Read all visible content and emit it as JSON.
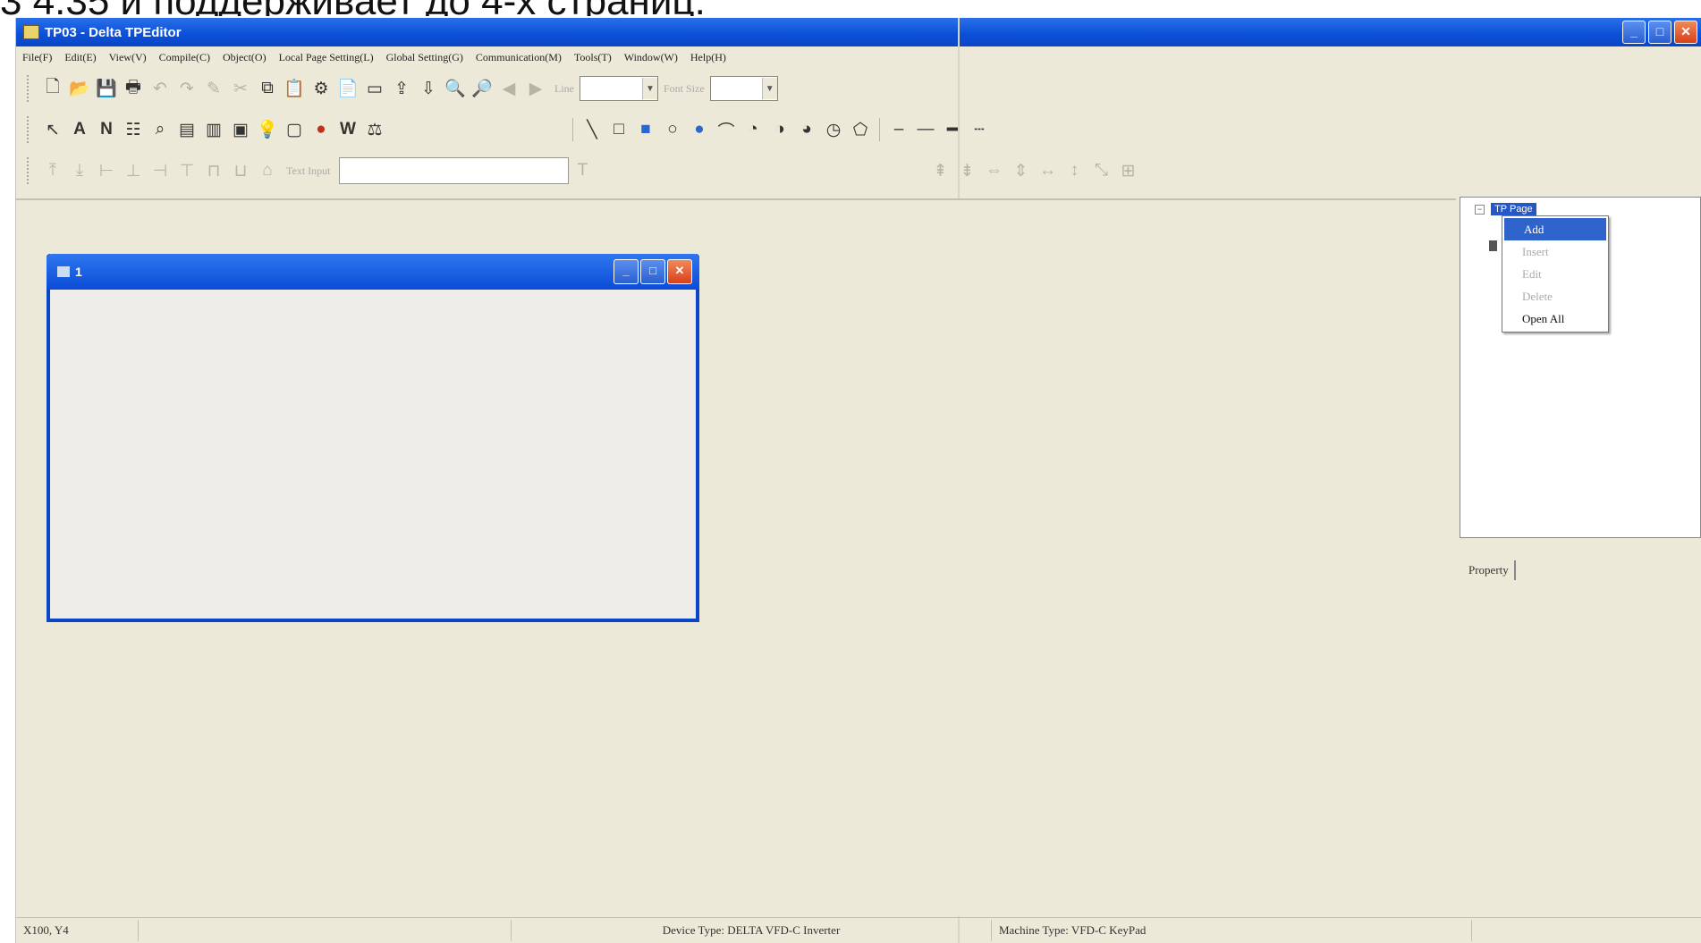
{
  "caption": "3 4.35 и поддерживает до 4-х страниц.",
  "window": {
    "title": "TP03 - Delta TPEditor",
    "minimize_icon": "minimize-icon",
    "maximize_icon": "maximize-icon",
    "close_icon": "close-icon"
  },
  "menu": [
    {
      "label": "File(F)"
    },
    {
      "label": "Edit(E)"
    },
    {
      "label": "View(V)"
    },
    {
      "label": "Compile(C)"
    },
    {
      "label": "Object(O)"
    },
    {
      "label": "Local Page Setting(L)"
    },
    {
      "label": "Global Setting(G)"
    },
    {
      "label": "Communication(M)"
    },
    {
      "label": "Tools(T)"
    },
    {
      "label": "Window(W)"
    },
    {
      "label": "Help(H)"
    }
  ],
  "toolbar": {
    "line_label": "Line",
    "font_size_label": "Font Size",
    "text_input_label": "Text Input"
  },
  "child_window": {
    "title": "1"
  },
  "tree": {
    "root": "TP Page"
  },
  "context_menu": [
    {
      "label": "Add"
    },
    {
      "label": "Insert"
    },
    {
      "label": "Edit"
    },
    {
      "label": "Delete"
    },
    {
      "label": "Open All"
    }
  ],
  "property": {
    "label": "Property"
  },
  "status": {
    "coords": "X100, Y4",
    "device": "Device Type: DELTA VFD-C Inverter",
    "machine": "Machine Type: VFD-C KeyPad"
  }
}
